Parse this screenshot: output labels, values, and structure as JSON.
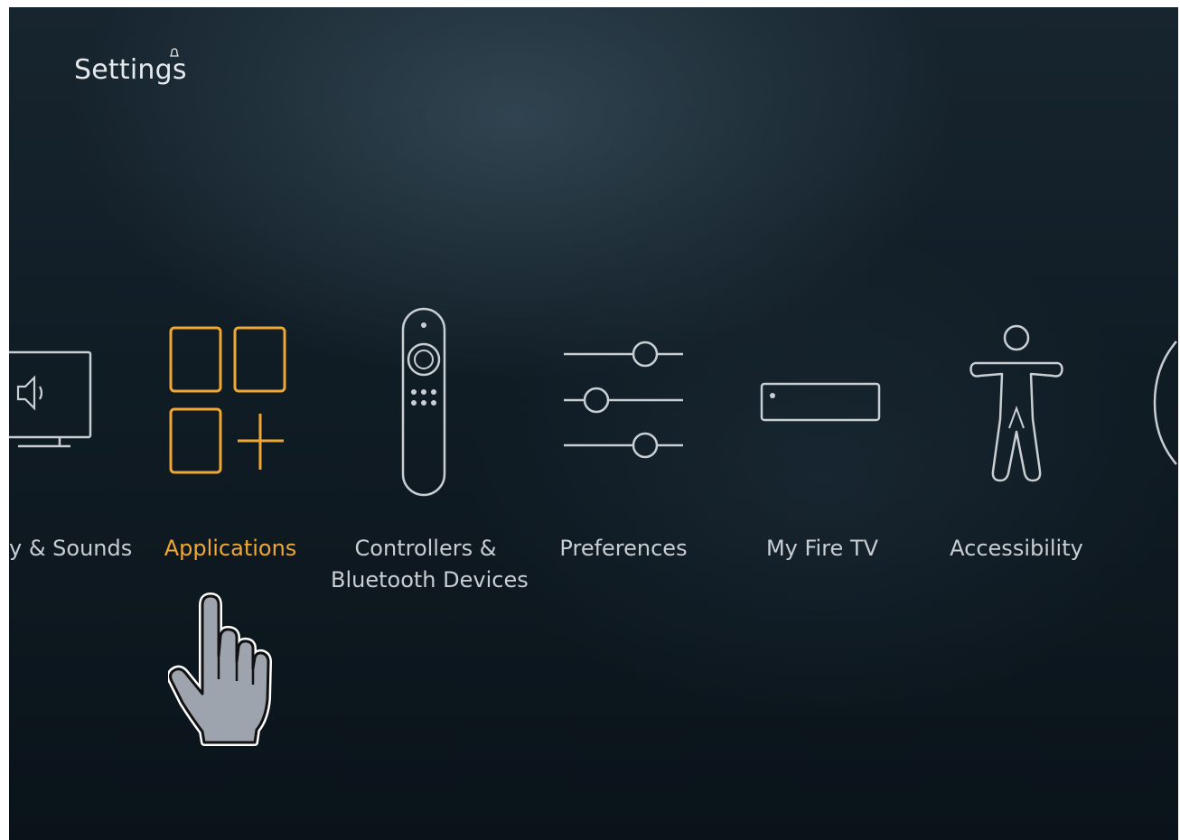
{
  "header": {
    "title": "Settings"
  },
  "menu": {
    "items": [
      {
        "label": "y & Sounds",
        "icon": "display-sounds-icon",
        "active": false
      },
      {
        "label": "Applications",
        "icon": "applications-icon",
        "active": true
      },
      {
        "label_line1": "Controllers &",
        "label_line2": "Bluetooth Devices",
        "icon": "remote-control-icon",
        "active": false
      },
      {
        "label": "Preferences",
        "icon": "sliders-icon",
        "active": false
      },
      {
        "label": "My Fire TV",
        "icon": "fire-tv-device-icon",
        "active": false
      },
      {
        "label": "Accessibility",
        "icon": "accessibility-icon",
        "active": false
      }
    ]
  },
  "colors": {
    "accent": "#f0a733",
    "text": "#c9ced3",
    "background": "#101c24"
  },
  "cursor": {
    "icon": "hand-pointer-icon"
  }
}
